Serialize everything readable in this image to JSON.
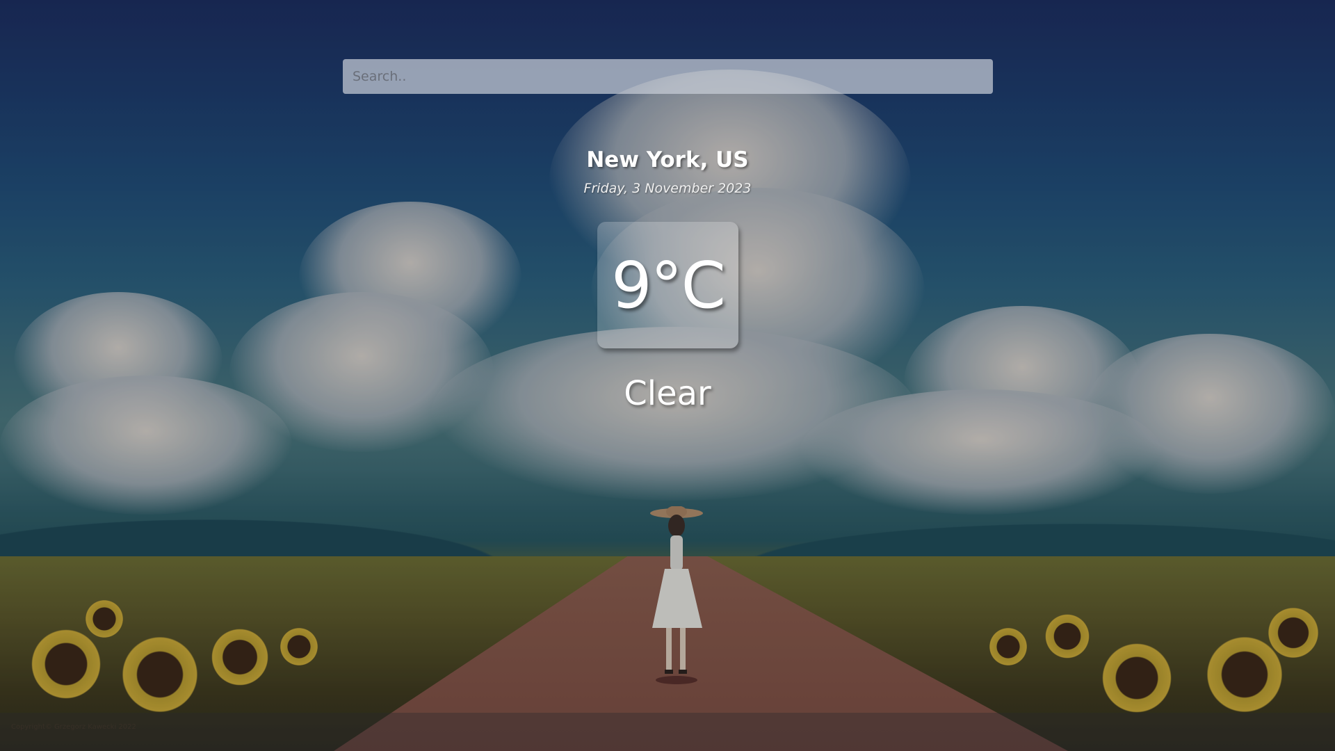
{
  "search": {
    "placeholder": "Search.."
  },
  "weather": {
    "location": "New York, US",
    "date": "Friday, 3 November 2023",
    "temperature": "9°C",
    "condition": "Clear"
  },
  "footer": {
    "copyright": "Copyright© Grzegorz Kawecki 2022"
  },
  "colors": {
    "sky_top": "#1a2a5a",
    "text": "#ffffff",
    "temp_box_bg": "rgba(255,255,255,0.22)"
  }
}
